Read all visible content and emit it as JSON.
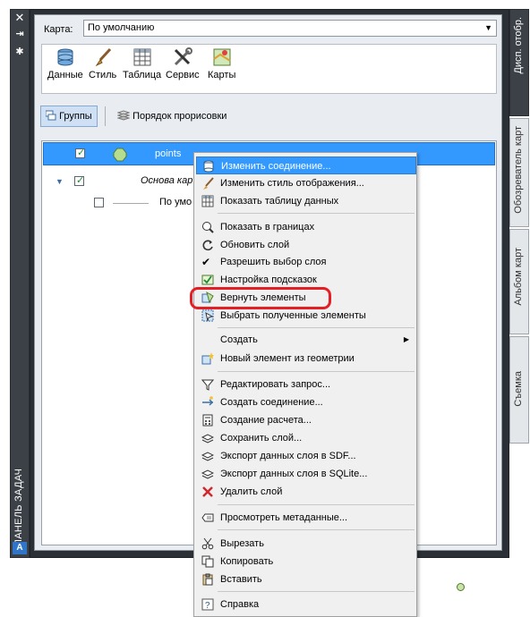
{
  "taskpane": {
    "title": "ПАНЕЛЬ ЗАДАЧ",
    "logo": "A",
    "controls": [
      "close-icon",
      "pin-icon",
      "properties-icon"
    ]
  },
  "map_selector": {
    "label": "Карта:",
    "value": "По умолчанию"
  },
  "tools": [
    {
      "label": "Данные",
      "icon": "database-icon"
    },
    {
      "label": "Стиль",
      "icon": "brush-icon"
    },
    {
      "label": "Таблица",
      "icon": "table-icon"
    },
    {
      "label": "Сервис",
      "icon": "tools-icon"
    },
    {
      "label": "Карты",
      "icon": "map-icon"
    }
  ],
  "view_tabs": {
    "groups": "Группы",
    "draw_order": "Порядок прорисовки"
  },
  "layers": [
    {
      "name": "points",
      "selected": true,
      "checked": true
    },
    {
      "name": "Основа кар",
      "checked": true
    },
    {
      "name": "По умо",
      "checked": false
    }
  ],
  "side_tabs": [
    "Дисп. отобр.",
    "Обозреватель карт",
    "Альбом карт",
    "Съемка"
  ],
  "context_menu": {
    "items": [
      {
        "label": "Изменить соединение...",
        "icon": "database-connect-icon",
        "highlighted": true
      },
      {
        "label": "Изменить стиль отображения...",
        "icon": "brush-icon"
      },
      {
        "label": "Показать таблицу данных",
        "icon": "table-icon"
      },
      {
        "label": "Показать в границах",
        "icon": "zoom-extents-icon"
      },
      {
        "label": "Обновить слой",
        "icon": "refresh-icon"
      },
      {
        "label": "Разрешить выбор слоя",
        "icon": "checkmark-icon"
      },
      {
        "label": "Настройка подсказок",
        "icon": "tooltip-settings-icon"
      },
      {
        "label": "Вернуть элементы",
        "icon": "return-features-icon"
      },
      {
        "label": "Выбрать полученные элементы",
        "icon": "select-features-icon"
      },
      {
        "label": "Создать",
        "icon": "",
        "submenu": true
      },
      {
        "label": "Новый элемент из геометрии",
        "icon": "new-feature-icon"
      },
      {
        "label": "Редактировать запрос...",
        "icon": "filter-icon"
      },
      {
        "label": "Создать соединение...",
        "icon": "join-icon"
      },
      {
        "label": "Создание расчета...",
        "icon": "calculator-icon"
      },
      {
        "label": "Сохранить слой...",
        "icon": "save-layer-icon"
      },
      {
        "label": "Экспорт данных слоя в SDF...",
        "icon": "export-sdf-icon"
      },
      {
        "label": "Экспорт данных слоя в SQLite...",
        "icon": "export-sqlite-icon"
      },
      {
        "label": "Удалить слой",
        "icon": "delete-icon"
      },
      {
        "label": "Просмотреть метаданные...",
        "icon": "metadata-icon"
      },
      {
        "label": "Вырезать",
        "icon": "scissors-icon"
      },
      {
        "label": "Копировать",
        "icon": "copy-icon"
      },
      {
        "label": "Вставить",
        "icon": "paste-icon"
      },
      {
        "label": "Справка",
        "icon": "help-icon"
      }
    ]
  },
  "annotation_color": "#e51e25",
  "accent_color": "#3399ff"
}
